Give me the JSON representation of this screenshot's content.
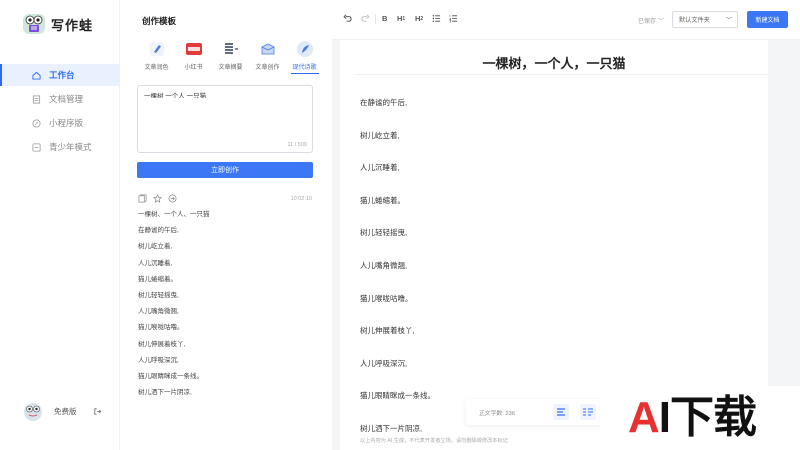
{
  "app": {
    "name": "写作蛙"
  },
  "sidebar": {
    "items": [
      {
        "label": "工作台",
        "icon": "home-icon",
        "active": true
      },
      {
        "label": "文档管理",
        "icon": "document-icon",
        "active": false
      },
      {
        "label": "小程序版",
        "icon": "miniprogram-icon",
        "active": false
      },
      {
        "label": "青少年模式",
        "icon": "teen-mode-icon",
        "active": false
      }
    ],
    "user": {
      "name": "免费版"
    }
  },
  "panel": {
    "title": "创作模板",
    "templates": [
      {
        "label": "文章润色",
        "icon": "brush-icon"
      },
      {
        "label": "小红书",
        "icon": "xiaohongshu-icon"
      },
      {
        "label": "文章摘要",
        "icon": "summary-icon"
      },
      {
        "label": "文章创作",
        "icon": "create-box-icon"
      },
      {
        "label": "现代诗歌",
        "icon": "poem-icon",
        "active": true
      }
    ],
    "input_value": "一棵树 一个人 一只猫",
    "counter": "11 / 500",
    "create_label": "立即创作",
    "result": {
      "time": "10:02:10",
      "lines": [
        "一棵树、一个人、一只猫",
        "在静谧的午后,",
        "树儿屹立着,",
        "人儿沉睡着,",
        "猫儿蜷缩着。",
        "树儿轻轻摇曳,",
        "人儿嘴角微翘,",
        "猫儿喉咙咕噜。",
        "树儿伸展着枝丫,",
        "人儿呼吸深沉,",
        "猫儿眼睛眯成一条线。",
        "树儿洒下一片阴凉,"
      ]
    }
  },
  "toolbar": {
    "bold": "B",
    "h1": "H",
    "h1_sub": "1",
    "h2": "H",
    "h2_sub": "2",
    "saved": "已保存",
    "folder": "默认文件夹",
    "new_doc": "新建文档"
  },
  "document": {
    "title": "一棵树，一个人，一只猫",
    "lines": [
      "在静谧的午后,",
      "树儿屹立着,",
      "人儿沉睡着,",
      "猫儿蜷缩着。",
      "树儿轻轻摇曳,",
      "人儿嘴角微翘,",
      "猫儿喉咙咕噜。",
      "树儿伸展着枝丫,",
      "人儿呼吸深沉,",
      "猫儿眼睛眯成一条线。",
      "树儿洒下一片阴凉,"
    ],
    "disclaimer": "以上内容为 AI 生成，不代表开发者立场，请勿删除或修改本标记",
    "word_count_label": "正文字数: 236"
  },
  "watermark": {
    "a": "A",
    "rest": "I下载"
  },
  "colors": {
    "accent": "#3c78f5",
    "active_bg": "#eaf1fe"
  }
}
